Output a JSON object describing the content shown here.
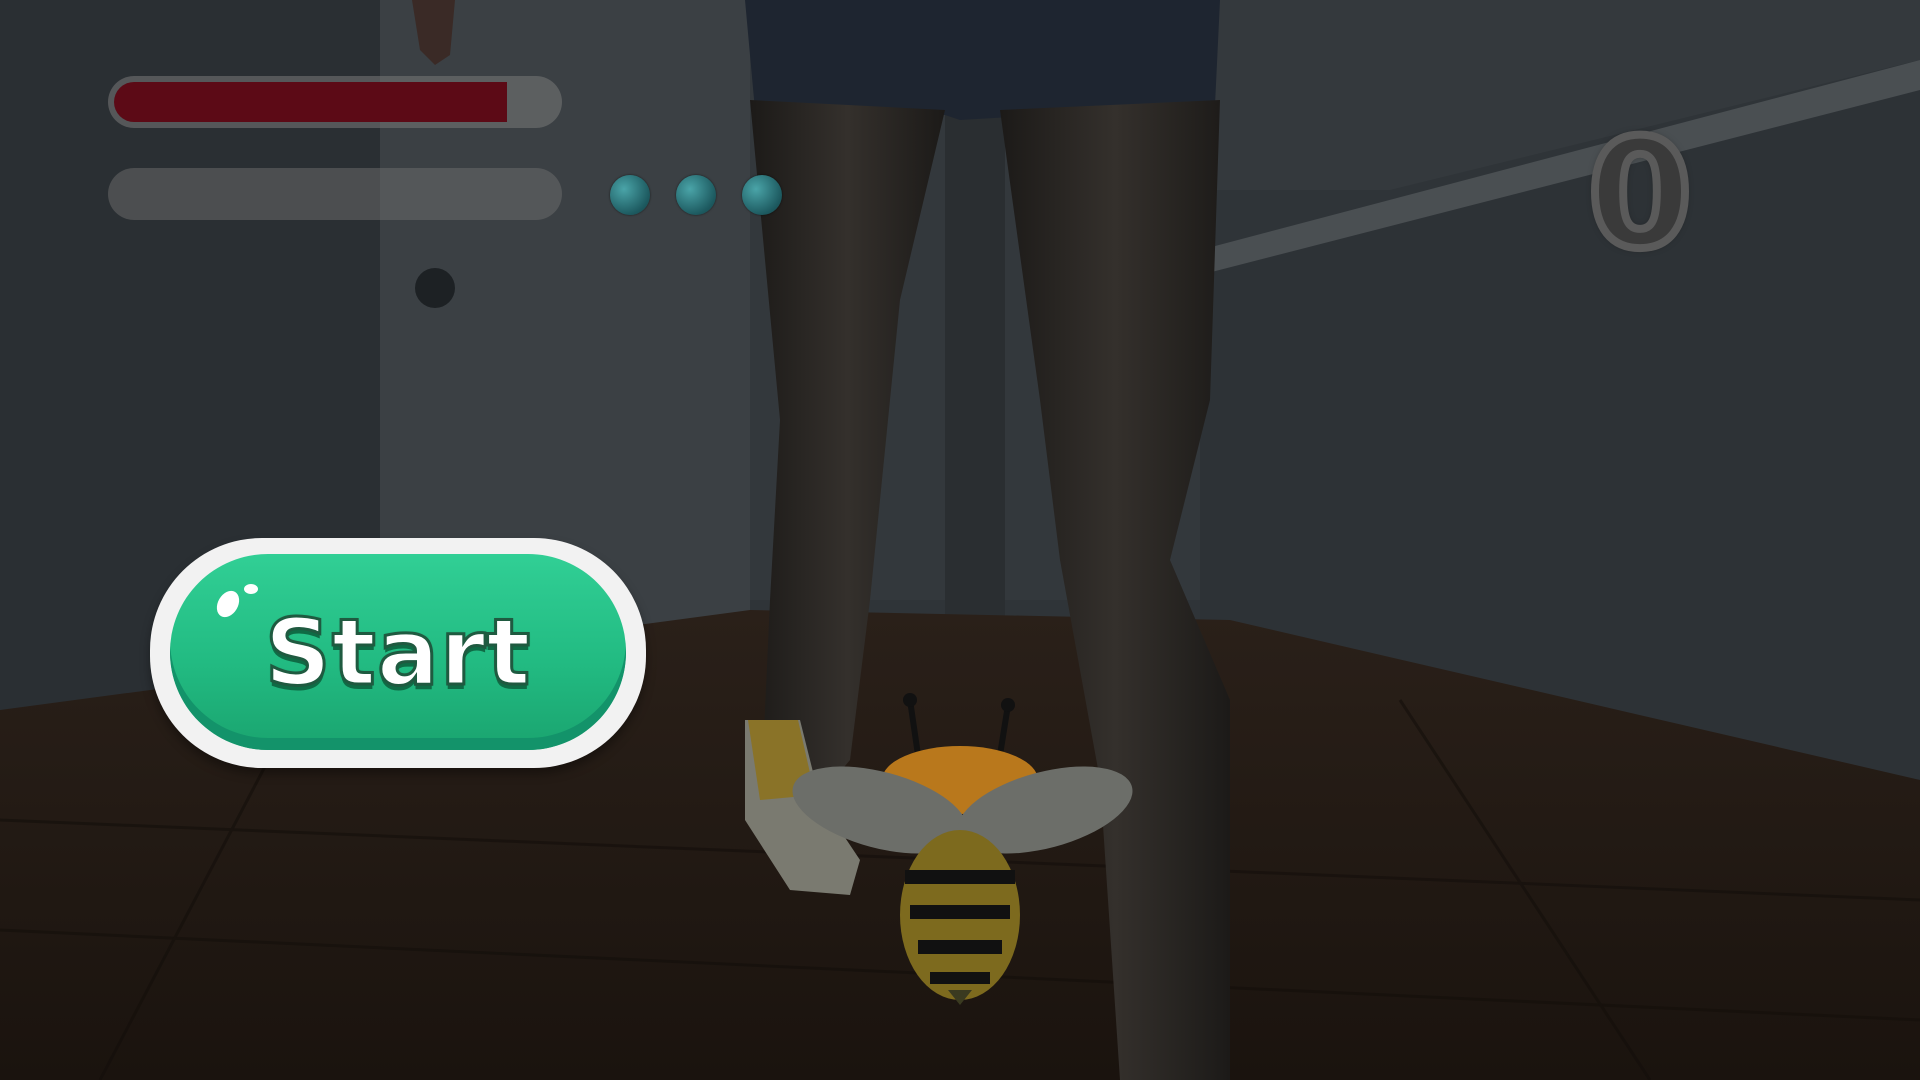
{
  "hud": {
    "health_fraction": 0.89,
    "energy_fraction": 0.0,
    "charges_total": 3,
    "charges_active": 3,
    "score": "0"
  },
  "start_button": {
    "label": "Start"
  },
  "colors": {
    "health": "#5c0a16",
    "start_button": "#22bb82",
    "charge": "#2c8a90"
  },
  "icons": {
    "player": "bee-character-icon",
    "charges": "orb-icon"
  }
}
